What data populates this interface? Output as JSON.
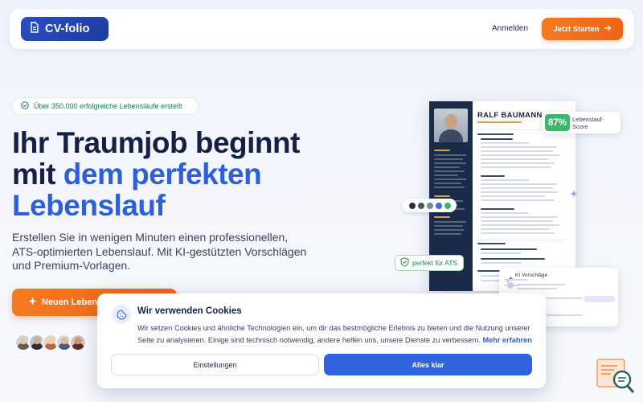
{
  "nav": {
    "logo_text": "CV-folio",
    "login_label": "Anmelden",
    "cta_label": "Jetzt Starten"
  },
  "hero": {
    "badge_text": "Über 350.000 erfolgreiche Lebensläufe erstellt",
    "title_line1": "Ihr Traumjob beginnt",
    "title_line2_plain": "mit ",
    "title_line2_accent": "dem perfekten",
    "title_line3_accent": "Lebenslauf",
    "lead": "Erstellen Sie in wenigen Minuten einen professionellen, ATS-optimierten Lebenslauf. Mit KI-gestützten Vorschlägen und Premium-Vorlagen.",
    "cta_label": "Neuen Lebens"
  },
  "preview": {
    "resume_name": "RALF BAUMANN",
    "score_value": "87%",
    "score_label": "Lebenslauf-Score",
    "ats_label": "perfekt für ATS",
    "ki_title": "KI Vorschläge",
    "swatch_colors": [
      "#2b2f3a",
      "#4a5568",
      "#7a8699",
      "#3b6fd8",
      "#3fb56b"
    ]
  },
  "cookie": {
    "title": "Wir verwenden Cookies",
    "text": "Wir setzen Cookies und ähnliche Technologien ein, um dir das bestmögliche Erlebnis zu bieten und die Nutzung unserer Seite zu analysieren. Einige sind technisch notwendig, andere helfen uns, unsere Dienste zu verbessern.",
    "link_label": "Mehr erfahren",
    "settings_label": "Einstellungen",
    "accept_label": "Alles klar"
  },
  "colors": {
    "brand_blue": "#2a4fc4",
    "accent_orange": "#f06516",
    "success_green": "#3fb56b"
  }
}
